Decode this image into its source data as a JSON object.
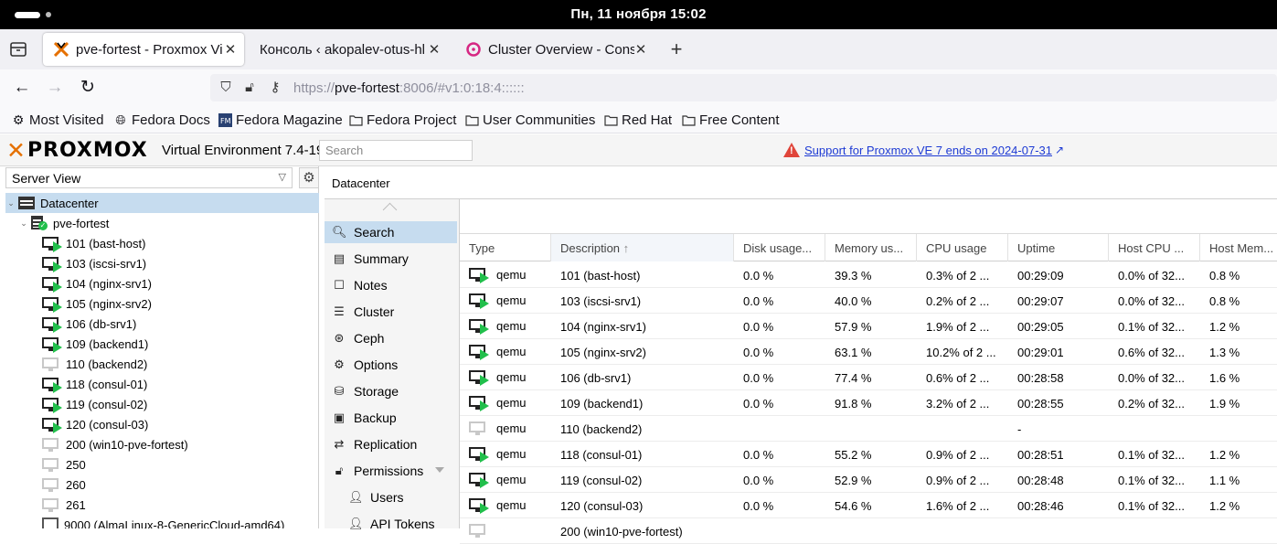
{
  "os": {
    "clock": "Пн, 11 ноября  15:02"
  },
  "browser": {
    "tabs": [
      {
        "title": "pve-fortest - Proxmox Vi",
        "active": true,
        "favicon": "proxmox-icon"
      },
      {
        "title": "Консоль ‹ akopalev-otus-hl",
        "active": false,
        "favicon": "none"
      },
      {
        "title": "Cluster Overview - Cons",
        "active": false,
        "favicon": "consul-icon"
      }
    ],
    "new_tab": "+",
    "url_host": "https://",
    "url_domain": "pve-fortest",
    "url_rest": ":8006/#v1:0:18:4::::::",
    "bookmarks": [
      {
        "label": "Most Visited",
        "icon": "gear-icon"
      },
      {
        "label": "Fedora Docs",
        "icon": "globe-icon"
      },
      {
        "label": "Fedora Magazine",
        "icon": "fm-icon"
      },
      {
        "label": "Fedora Project",
        "icon": "folder-icon"
      },
      {
        "label": "User Communities",
        "icon": "folder-icon"
      },
      {
        "label": "Red Hat",
        "icon": "folder-icon"
      },
      {
        "label": "Free Content",
        "icon": "folder-icon"
      }
    ]
  },
  "pve": {
    "logo": "PROXMOX",
    "version": "Virtual Environment 7.4-19",
    "search_placeholder": "Search",
    "warning_link": "Support for Proxmox VE 7 ends on 2024-07-31",
    "view_selector": "Server View",
    "tree": [
      {
        "label": "Datacenter",
        "kind": "datacenter",
        "level": 0,
        "selected": true
      },
      {
        "label": "pve-fortest",
        "kind": "node",
        "level": 1
      },
      {
        "label": "101 (bast-host)",
        "kind": "vm-running",
        "level": 2
      },
      {
        "label": "103 (iscsi-srv1)",
        "kind": "vm-running",
        "level": 2
      },
      {
        "label": "104 (nginx-srv1)",
        "kind": "vm-running",
        "level": 2
      },
      {
        "label": "105 (nginx-srv2)",
        "kind": "vm-running",
        "level": 2
      },
      {
        "label": "106 (db-srv1)",
        "kind": "vm-running",
        "level": 2
      },
      {
        "label": "109 (backend1)",
        "kind": "vm-running",
        "level": 2
      },
      {
        "label": "110 (backend2)",
        "kind": "vm-stopped",
        "level": 2
      },
      {
        "label": "118 (consul-01)",
        "kind": "vm-running",
        "level": 2
      },
      {
        "label": "119 (consul-02)",
        "kind": "vm-running",
        "level": 2
      },
      {
        "label": "120 (consul-03)",
        "kind": "vm-running",
        "level": 2
      },
      {
        "label": "200 (win10-pve-fortest)",
        "kind": "vm-stopped",
        "level": 2
      },
      {
        "label": "250",
        "kind": "vm-stopped",
        "level": 2
      },
      {
        "label": "260",
        "kind": "vm-stopped",
        "level": 2
      },
      {
        "label": "261",
        "kind": "vm-stopped",
        "level": 2
      },
      {
        "label": "9000 (AlmaLinux-8-GenericCloud-amd64)",
        "kind": "template",
        "level": 2
      }
    ],
    "content_title": "Datacenter",
    "menu": [
      {
        "label": "Search",
        "icon": "search-icon",
        "selected": true
      },
      {
        "label": "Summary",
        "icon": "book-icon"
      },
      {
        "label": "Notes",
        "icon": "notes-icon"
      },
      {
        "label": "Cluster",
        "icon": "server-icon"
      },
      {
        "label": "Ceph",
        "icon": "ceph-icon"
      },
      {
        "label": "Options",
        "icon": "gear-icon"
      },
      {
        "label": "Storage",
        "icon": "database-icon"
      },
      {
        "label": "Backup",
        "icon": "floppy-icon"
      },
      {
        "label": "Replication",
        "icon": "retweet-icon"
      },
      {
        "label": "Permissions",
        "icon": "unlock-icon",
        "expandable": true
      },
      {
        "label": "Users",
        "icon": "user-icon",
        "sub": true
      },
      {
        "label": "API Tokens",
        "icon": "user-tag-icon",
        "sub": true
      }
    ],
    "grid": {
      "columns": [
        "Type",
        "Description",
        "Disk usage...",
        "Memory us...",
        "CPU usage",
        "Uptime",
        "Host CPU ...",
        "Host Mem..."
      ],
      "sort_indicator": "↑",
      "rows": [
        {
          "type": "qemu",
          "running": true,
          "desc": "101 (bast-host)",
          "disk": "0.0 %",
          "mem": "39.3 %",
          "cpu": "0.3% of 2 ...",
          "uptime": "00:29:09",
          "hcpu": "0.0% of 32...",
          "hmem": "0.8 %"
        },
        {
          "type": "qemu",
          "running": true,
          "desc": "103 (iscsi-srv1)",
          "disk": "0.0 %",
          "mem": "40.0 %",
          "cpu": "0.2% of 2 ...",
          "uptime": "00:29:07",
          "hcpu": "0.0% of 32...",
          "hmem": "0.8 %"
        },
        {
          "type": "qemu",
          "running": true,
          "desc": "104 (nginx-srv1)",
          "disk": "0.0 %",
          "mem": "57.9 %",
          "cpu": "1.9% of 2 ...",
          "uptime": "00:29:05",
          "hcpu": "0.1% of 32...",
          "hmem": "1.2 %"
        },
        {
          "type": "qemu",
          "running": true,
          "desc": "105 (nginx-srv2)",
          "disk": "0.0 %",
          "mem": "63.1 %",
          "cpu": "10.2% of 2 ...",
          "uptime": "00:29:01",
          "hcpu": "0.6% of 32...",
          "hmem": "1.3 %"
        },
        {
          "type": "qemu",
          "running": true,
          "desc": "106 (db-srv1)",
          "disk": "0.0 %",
          "mem": "77.4 %",
          "cpu": "0.6% of 2 ...",
          "uptime": "00:28:58",
          "hcpu": "0.0% of 32...",
          "hmem": "1.6 %"
        },
        {
          "type": "qemu",
          "running": true,
          "desc": "109 (backend1)",
          "disk": "0.0 %",
          "mem": "91.8 %",
          "cpu": "3.2% of 2 ...",
          "uptime": "00:28:55",
          "hcpu": "0.2% of 32...",
          "hmem": "1.9 %"
        },
        {
          "type": "qemu",
          "running": false,
          "desc": "110 (backend2)",
          "disk": "",
          "mem": "",
          "cpu": "",
          "uptime": "-",
          "hcpu": "",
          "hmem": ""
        },
        {
          "type": "qemu",
          "running": true,
          "desc": "118 (consul-01)",
          "disk": "0.0 %",
          "mem": "55.2 %",
          "cpu": "0.9% of 2 ...",
          "uptime": "00:28:51",
          "hcpu": "0.1% of 32...",
          "hmem": "1.2 %"
        },
        {
          "type": "qemu",
          "running": true,
          "desc": "119 (consul-02)",
          "disk": "0.0 %",
          "mem": "52.9 %",
          "cpu": "0.9% of 2 ...",
          "uptime": "00:28:48",
          "hcpu": "0.1% of 32...",
          "hmem": "1.1 %"
        },
        {
          "type": "qemu",
          "running": true,
          "desc": "120 (consul-03)",
          "disk": "0.0 %",
          "mem": "54.6 %",
          "cpu": "1.6% of 2 ...",
          "uptime": "00:28:46",
          "hcpu": "0.1% of 32...",
          "hmem": "1.2 %"
        },
        {
          "type": "",
          "running": false,
          "desc": "200 (win10-pve-fortest)",
          "disk": "",
          "mem": "",
          "cpu": "",
          "uptime": "",
          "hcpu": "",
          "hmem": ""
        }
      ]
    }
  },
  "colors": {
    "accent_orange": "#e57000",
    "running_green": "#21bf4b",
    "selection_blue": "#c6dcef",
    "warn_red": "#e0453a"
  }
}
